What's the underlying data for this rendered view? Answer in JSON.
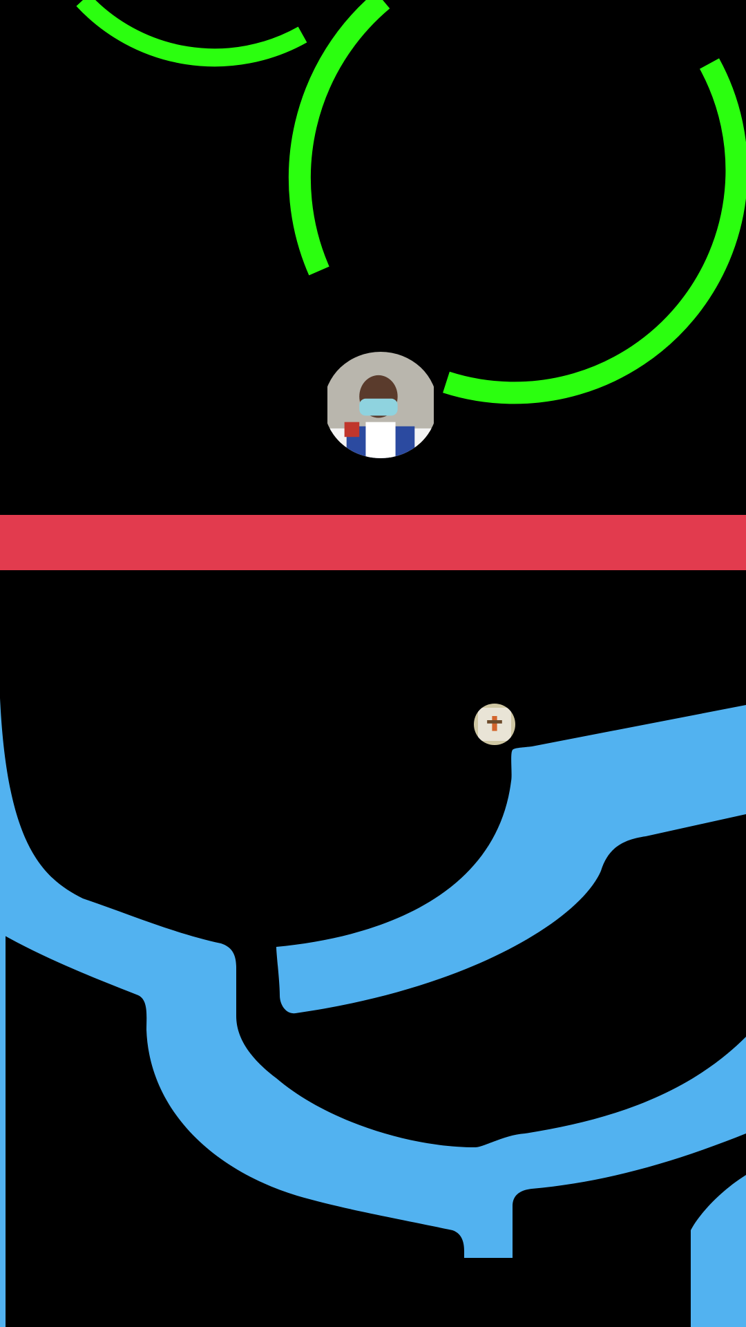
{
  "game": {
    "opponent_zone_color": "#000000",
    "player_zone_color": "#000000",
    "divider_color": "#E23B4E",
    "opponent_track_color": "#2BFF0F",
    "player_track_color": "#52B2F0"
  },
  "opponent": {
    "avatar": "masked-player-photo",
    "orientation": "upside-down"
  },
  "player": {
    "avatar": "small-figure-photo"
  }
}
